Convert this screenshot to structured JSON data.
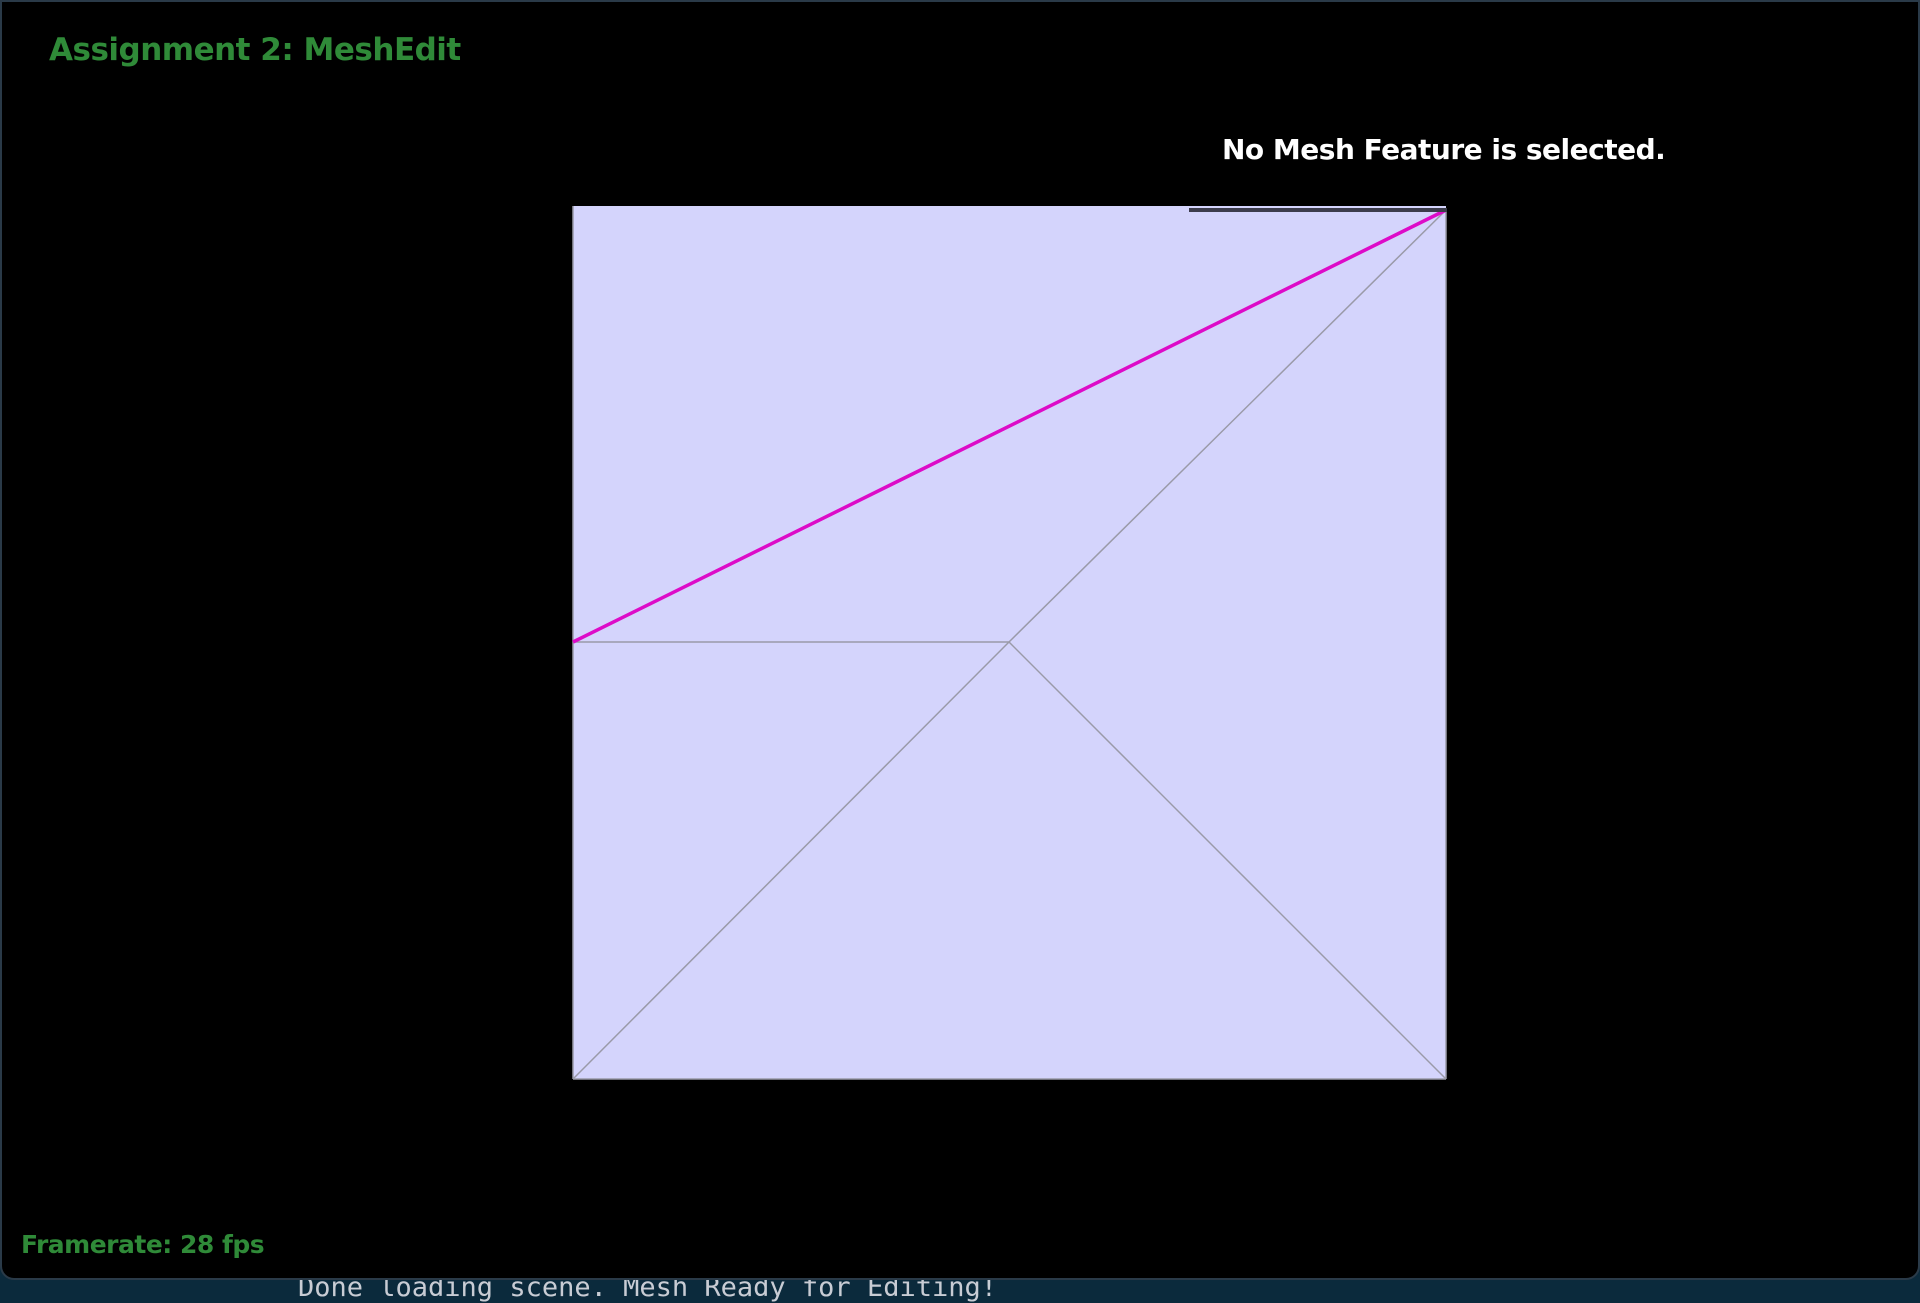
{
  "window": {
    "title": "Assignment 2: MeshEdit"
  },
  "overlay": {
    "selection_status": "No Mesh Feature is selected.",
    "framerate": "Framerate: 28 fps"
  },
  "console": {
    "message": "Done loading scene. Mesh Ready for Editing!"
  },
  "mesh": {
    "face_color": "#d4d4fc",
    "edge_color": "#9a9aa8",
    "highlight_edge_color": "#dd0bc8"
  }
}
